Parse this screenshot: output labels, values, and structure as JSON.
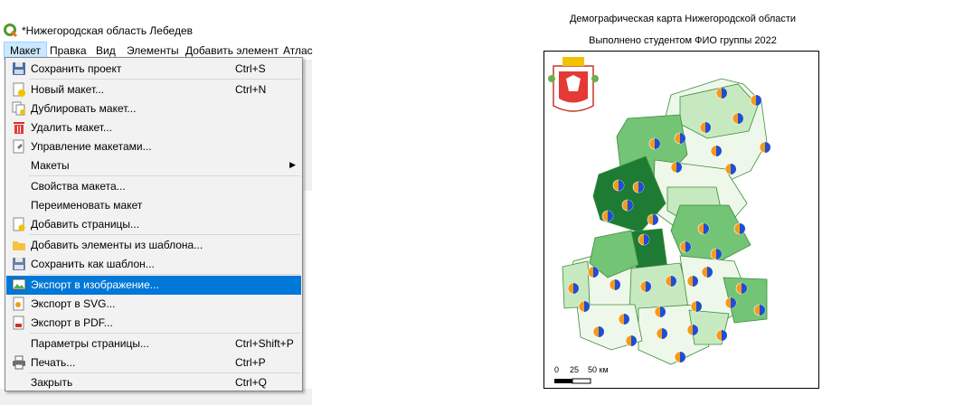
{
  "window": {
    "title": "*Нижегородская область Лебедев"
  },
  "menubar": [
    "Макет",
    "Правка",
    "Вид",
    "Элементы",
    "Добавить элемент",
    "Атлас"
  ],
  "menu": {
    "items": [
      {
        "label": "Сохранить проект",
        "shortcut": "Ctrl+S",
        "icon": "save-icon"
      },
      {
        "label": "Новый макет...",
        "shortcut": "Ctrl+N",
        "icon": "new-layout-icon"
      },
      {
        "label": "Дублировать макет...",
        "shortcut": "",
        "icon": "duplicate-layout-icon"
      },
      {
        "label": "Удалить макет...",
        "shortcut": "",
        "icon": "delete-icon"
      },
      {
        "label": "Управление макетами...",
        "shortcut": "",
        "icon": "layout-manager-icon"
      },
      {
        "label": "Макеты",
        "shortcut": "",
        "icon": ""
      },
      {
        "label": "Свойства макета...",
        "shortcut": "",
        "icon": ""
      },
      {
        "label": "Переименовать макет",
        "shortcut": "",
        "icon": ""
      },
      {
        "label": "Добавить страницы...",
        "shortcut": "",
        "icon": "add-pages-icon"
      },
      {
        "label": "Добавить элементы из шаблона...",
        "shortcut": "",
        "icon": "folder-icon"
      },
      {
        "label": "Сохранить как шаблон...",
        "shortcut": "",
        "icon": "save-template-icon"
      },
      {
        "label": "Экспорт в изображение...",
        "shortcut": "",
        "icon": "export-image-icon"
      },
      {
        "label": "Экспорт в SVG...",
        "shortcut": "",
        "icon": "export-svg-icon"
      },
      {
        "label": "Экспорт в PDF...",
        "shortcut": "",
        "icon": "export-pdf-icon"
      },
      {
        "label": "Параметры страницы...",
        "shortcut": "Ctrl+Shift+P",
        "icon": ""
      },
      {
        "label": "Печать...",
        "shortcut": "Ctrl+P",
        "icon": "print-icon"
      },
      {
        "label": "Закрыть",
        "shortcut": "Ctrl+Q",
        "icon": ""
      }
    ],
    "highlighted": "Экспорт в изображение..."
  },
  "map": {
    "title": "Демографическая карта Нижегородской области",
    "subtitle": "Выполнено студентом ФИО группы 2022",
    "scale_labels": [
      "0",
      "25",
      "50 км"
    ]
  },
  "colors": {
    "accent": "#0078d7",
    "dark_green": "#1e7b34",
    "mid_green": "#74c476",
    "light_green": "#c7e9c0",
    "pale_green": "#eef8ea",
    "pie_blue": "#1f4fd1",
    "pie_orange": "#f39a1e"
  }
}
